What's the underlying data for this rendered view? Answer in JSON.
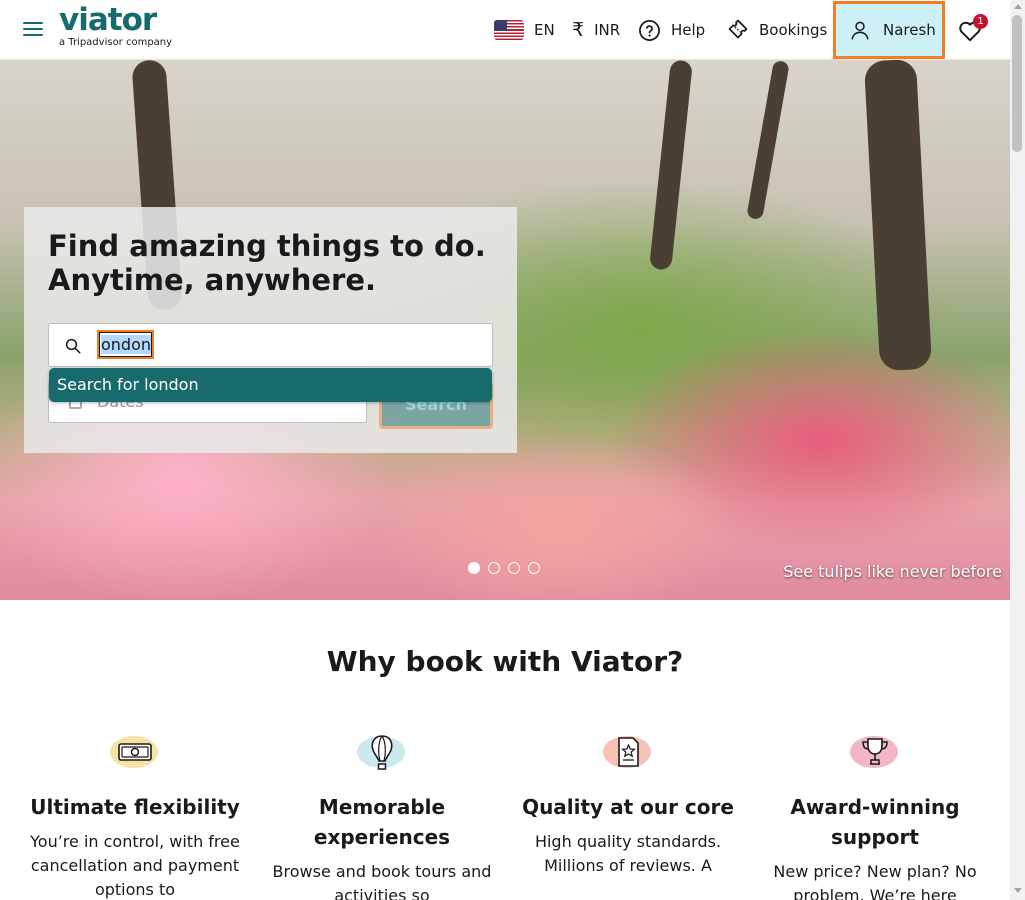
{
  "header": {
    "logo_text": "viator",
    "logo_sub": "a Tripadvisor company",
    "language": "EN",
    "currency_symbol": "₹",
    "currency": "INR",
    "help": "Help",
    "bookings": "Bookings",
    "user": "Naresh",
    "wishlist_count": "1"
  },
  "hero": {
    "title_line1": "Find amazing things to do.",
    "title_line2": "Anytime, anywhere.",
    "search_value": "london",
    "search_visible": "ondon",
    "suggestion": "Search for london",
    "dates_placeholder": "Dates",
    "search_button": "Search",
    "caption": "See tulips like never before",
    "slide_count": 4,
    "active_slide": 1
  },
  "why": {
    "title": "Why book with Viator?",
    "features": [
      {
        "title": "Ultimate flexibility",
        "text": "You’re in control, with free cancellation and payment options to"
      },
      {
        "title": "Memorable experiences",
        "text": "Browse and book tours and activities so"
      },
      {
        "title": "Quality at our core",
        "text": "High quality standards. Millions of reviews. A"
      },
      {
        "title": "Award-winning support",
        "text": "New price? New plan? No problem. We’re here"
      }
    ]
  },
  "colors": {
    "brand": "#186b6d",
    "focus": "#f17e23",
    "user_bg": "#ccf0f5",
    "badge": "#c8102e"
  }
}
